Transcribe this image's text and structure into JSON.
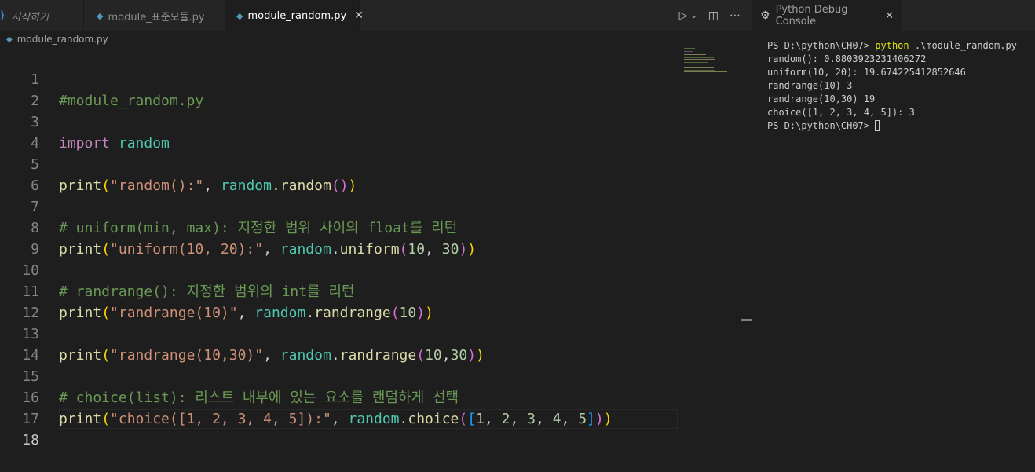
{
  "tabs": [
    {
      "label": "시작하기"
    },
    {
      "label": "module_표준모듈.py"
    },
    {
      "label": "module_random.py"
    }
  ],
  "breadcrumb": {
    "file": "module_random.py"
  },
  "editor": {
    "current_line": 18,
    "lines": [
      {
        "n": "1",
        "text": "#module_random.py"
      },
      {
        "n": "2",
        "text": ""
      },
      {
        "n": "3",
        "text": "import random"
      },
      {
        "n": "4",
        "text": ""
      },
      {
        "n": "5",
        "text": "print(\"random():\", random.random())"
      },
      {
        "n": "6",
        "text": ""
      },
      {
        "n": "7",
        "text": "# uniform(min, max): 지정한 범위 사이의 float를 리턴"
      },
      {
        "n": "8",
        "text": "print(\"uniform(10, 20):\", random.uniform(10, 30))"
      },
      {
        "n": "9",
        "text": ""
      },
      {
        "n": "10",
        "text": "# randrange(): 지정한 범위의 int를 리턴"
      },
      {
        "n": "11",
        "text": "print(\"randrange(10)\", random.randrange(10))"
      },
      {
        "n": "12",
        "text": ""
      },
      {
        "n": "13",
        "text": "print(\"randrange(10,30)\", random.randrange(10,30))"
      },
      {
        "n": "14",
        "text": ""
      },
      {
        "n": "15",
        "text": "# choice(list): 리스트 내부에 있는 요소를 랜덤하게 선택"
      },
      {
        "n": "16",
        "text": "print(\"choice([1, 2, 3, 4, 5]):\", random.choice([1, 2, 3, 4, 5]))"
      },
      {
        "n": "17",
        "text": ""
      },
      {
        "n": "18",
        "text": ""
      }
    ]
  },
  "panel": {
    "tab_label": "Python Debug Console",
    "terminal": {
      "prompt": "PS D:\\python\\CH07> ",
      "command_python": "python",
      "command_args": " .\\module_random.py",
      "output": [
        "random(): 0.8803923231406272",
        "uniform(10, 20): 19.674225412852646",
        "randrange(10) 3",
        "randrange(10,30) 19",
        "choice([1, 2, 3, 4, 5]): 3"
      ],
      "final_prompt": "PS D:\\python\\CH07> "
    }
  },
  "icons": {
    "vscode": "vscode-icon",
    "python_file": "python-file-icon",
    "close": "close-icon",
    "run": "run-icon",
    "split": "split-editor-icon",
    "more": "more-actions-icon",
    "debug": "debug-console-icon"
  },
  "colors": {
    "comment": "#6a9955",
    "keyword": "#c586c0",
    "module": "#4ec9b0",
    "function": "#dcdcaa",
    "string": "#ce9178",
    "number": "#b5cea8",
    "terminal_command": "#e5e510"
  }
}
